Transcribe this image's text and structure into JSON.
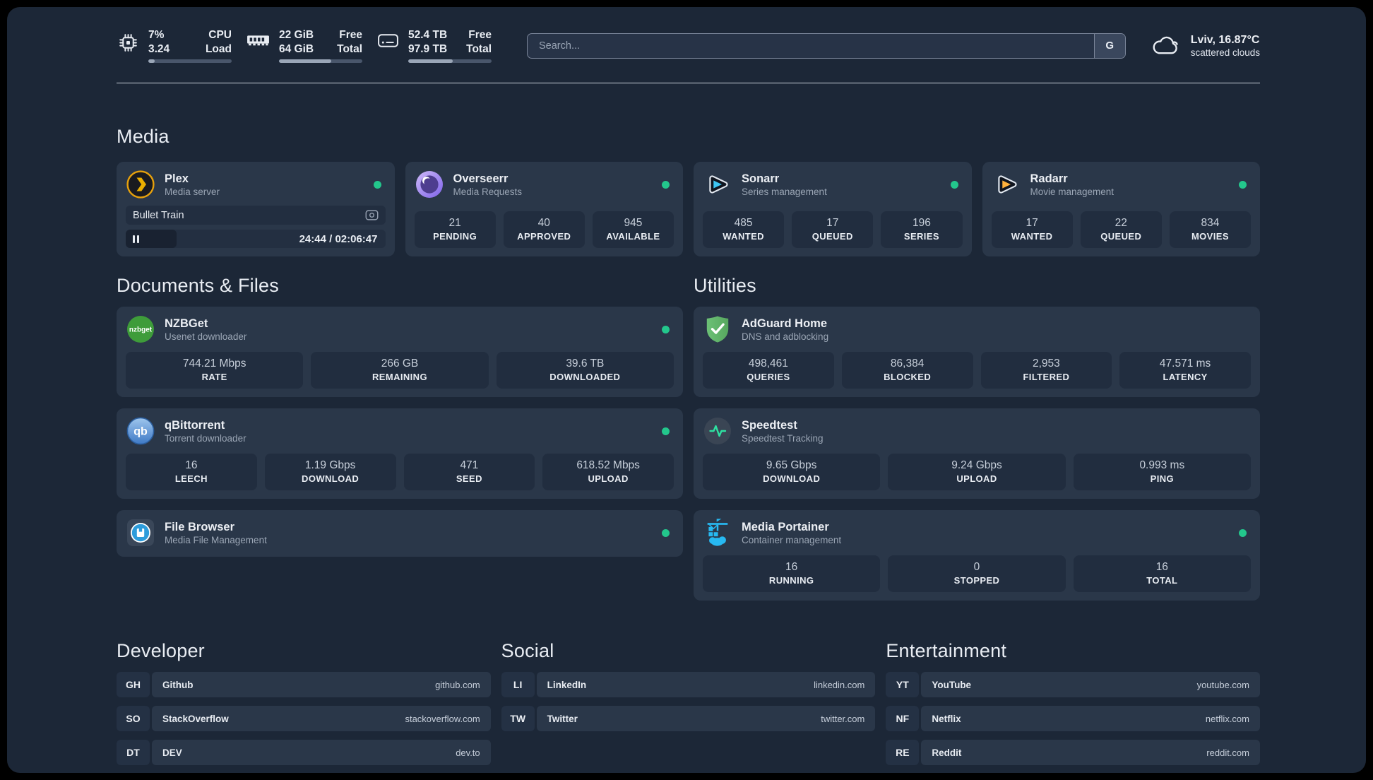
{
  "header": {
    "cpu": {
      "value_top": "7%",
      "value_bottom": "3.24",
      "label_top": "CPU",
      "label_bottom": "Load",
      "progress": 8
    },
    "memory": {
      "value_top": "22 GiB",
      "value_bottom": "64 GiB",
      "label_top": "Free",
      "label_bottom": "Total",
      "progress": 63
    },
    "disk": {
      "value_top": "52.4 TB",
      "value_bottom": "97.9 TB",
      "label_top": "Free",
      "label_bottom": "Total",
      "progress": 53
    },
    "search": {
      "placeholder": "Search...",
      "engine_button": "G"
    },
    "weather": {
      "location": "Lviv, 16.87°C",
      "condition": "scattered clouds",
      "icon": "cloud-icon"
    }
  },
  "sections": {
    "media": {
      "title": "Media",
      "apps": [
        {
          "name": "Plex",
          "desc": "Media server",
          "icon": "plex-icon",
          "online": true,
          "player": {
            "title": "Bullet Train",
            "time": "24:44 / 02:06:47",
            "progress": 19.5,
            "state": "paused"
          }
        },
        {
          "name": "Overseerr",
          "desc": "Media Requests",
          "icon": "overseerr-icon",
          "online": true,
          "stats": [
            {
              "value": "21",
              "label": "PENDING"
            },
            {
              "value": "40",
              "label": "APPROVED"
            },
            {
              "value": "945",
              "label": "AVAILABLE"
            }
          ]
        },
        {
          "name": "Sonarr",
          "desc": "Series management",
          "icon": "sonarr-icon",
          "online": true,
          "stats": [
            {
              "value": "485",
              "label": "WANTED"
            },
            {
              "value": "17",
              "label": "QUEUED"
            },
            {
              "value": "196",
              "label": "SERIES"
            }
          ]
        },
        {
          "name": "Radarr",
          "desc": "Movie management",
          "icon": "radarr-icon",
          "online": true,
          "stats": [
            {
              "value": "17",
              "label": "WANTED"
            },
            {
              "value": "22",
              "label": "QUEUED"
            },
            {
              "value": "834",
              "label": "MOVIES"
            }
          ]
        }
      ]
    },
    "documents": {
      "title": "Documents & Files",
      "apps": [
        {
          "name": "NZBGet",
          "desc": "Usenet downloader",
          "icon": "nzbget-icon",
          "online": true,
          "stats": [
            {
              "value": "744.21 Mbps",
              "label": "RATE"
            },
            {
              "value": "266 GB",
              "label": "REMAINING"
            },
            {
              "value": "39.6 TB",
              "label": "DOWNLOADED"
            }
          ]
        },
        {
          "name": "qBittorrent",
          "desc": "Torrent downloader",
          "icon": "qbittorrent-icon",
          "online": true,
          "stats": [
            {
              "value": "16",
              "label": "LEECH"
            },
            {
              "value": "1.19 Gbps",
              "label": "DOWNLOAD"
            },
            {
              "value": "471",
              "label": "SEED"
            },
            {
              "value": "618.52 Mbps",
              "label": "UPLOAD"
            }
          ]
        },
        {
          "name": "File Browser",
          "desc": "Media File Management",
          "icon": "filebrowser-icon",
          "online": true
        }
      ]
    },
    "utilities": {
      "title": "Utilities",
      "apps": [
        {
          "name": "AdGuard Home",
          "desc": "DNS and adblocking",
          "icon": "adguard-icon",
          "online": false,
          "stats": [
            {
              "value": "498,461",
              "label": "QUERIES"
            },
            {
              "value": "86,384",
              "label": "BLOCKED"
            },
            {
              "value": "2,953",
              "label": "FILTERED"
            },
            {
              "value": "47.571 ms",
              "label": "LATENCY"
            }
          ]
        },
        {
          "name": "Speedtest",
          "desc": "Speedtest Tracking",
          "icon": "speedtest-icon",
          "online": false,
          "stats": [
            {
              "value": "9.65 Gbps",
              "label": "DOWNLOAD"
            },
            {
              "value": "9.24 Gbps",
              "label": "UPLOAD"
            },
            {
              "value": "0.993 ms",
              "label": "PING"
            }
          ]
        },
        {
          "name": "Media Portainer",
          "desc": "Container management",
          "icon": "portainer-icon",
          "online": true,
          "stats": [
            {
              "value": "16",
              "label": "RUNNING"
            },
            {
              "value": "0",
              "label": "STOPPED"
            },
            {
              "value": "16",
              "label": "TOTAL"
            }
          ]
        }
      ]
    }
  },
  "link_sections": [
    {
      "title": "Developer",
      "links": [
        {
          "tag": "GH",
          "name": "Github",
          "url": "github.com"
        },
        {
          "tag": "SO",
          "name": "StackOverflow",
          "url": "stackoverflow.com"
        },
        {
          "tag": "DT",
          "name": "DEV",
          "url": "dev.to"
        }
      ]
    },
    {
      "title": "Social",
      "links": [
        {
          "tag": "LI",
          "name": "LinkedIn",
          "url": "linkedin.com"
        },
        {
          "tag": "TW",
          "name": "Twitter",
          "url": "twitter.com"
        }
      ]
    },
    {
      "title": "Entertainment",
      "links": [
        {
          "tag": "YT",
          "name": "YouTube",
          "url": "youtube.com"
        },
        {
          "tag": "NF",
          "name": "Netflix",
          "url": "netflix.com"
        },
        {
          "tag": "RE",
          "name": "Reddit",
          "url": "reddit.com"
        }
      ]
    }
  ],
  "colors": {
    "status_online": "#23C78C",
    "panel_bg": "#1C2737",
    "card_bg": "#2A3749",
    "stat_bg": "#212D3F"
  }
}
